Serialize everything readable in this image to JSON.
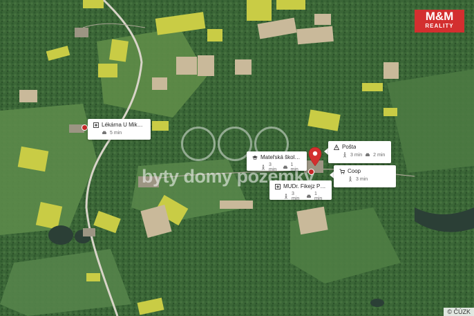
{
  "logo": {
    "text": "M&M",
    "subtext": "REALITY"
  },
  "watermark": "byty domy pozemky",
  "copyright": "© ČÚZK",
  "colors": {
    "marker": "#d32f2f",
    "logo": "#d32f2f"
  },
  "pois": [
    {
      "icon": "pharmacy-icon",
      "name": "Lékárna U Mikolá...",
      "car": "5 min"
    },
    {
      "icon": "school-icon",
      "name": "Mateřská škola O...",
      "walk": "3 min",
      "car": "1 min"
    },
    {
      "icon": "post-icon",
      "name": "Pošta",
      "walk": "3 min",
      "car": "2 min"
    },
    {
      "icon": "shop-icon",
      "name": "Coop",
      "walk": "3 min"
    },
    {
      "icon": "doctor-icon",
      "name": "MUDr. Fikejz Petr...",
      "walk": "3 min",
      "car": "1 min"
    }
  ]
}
